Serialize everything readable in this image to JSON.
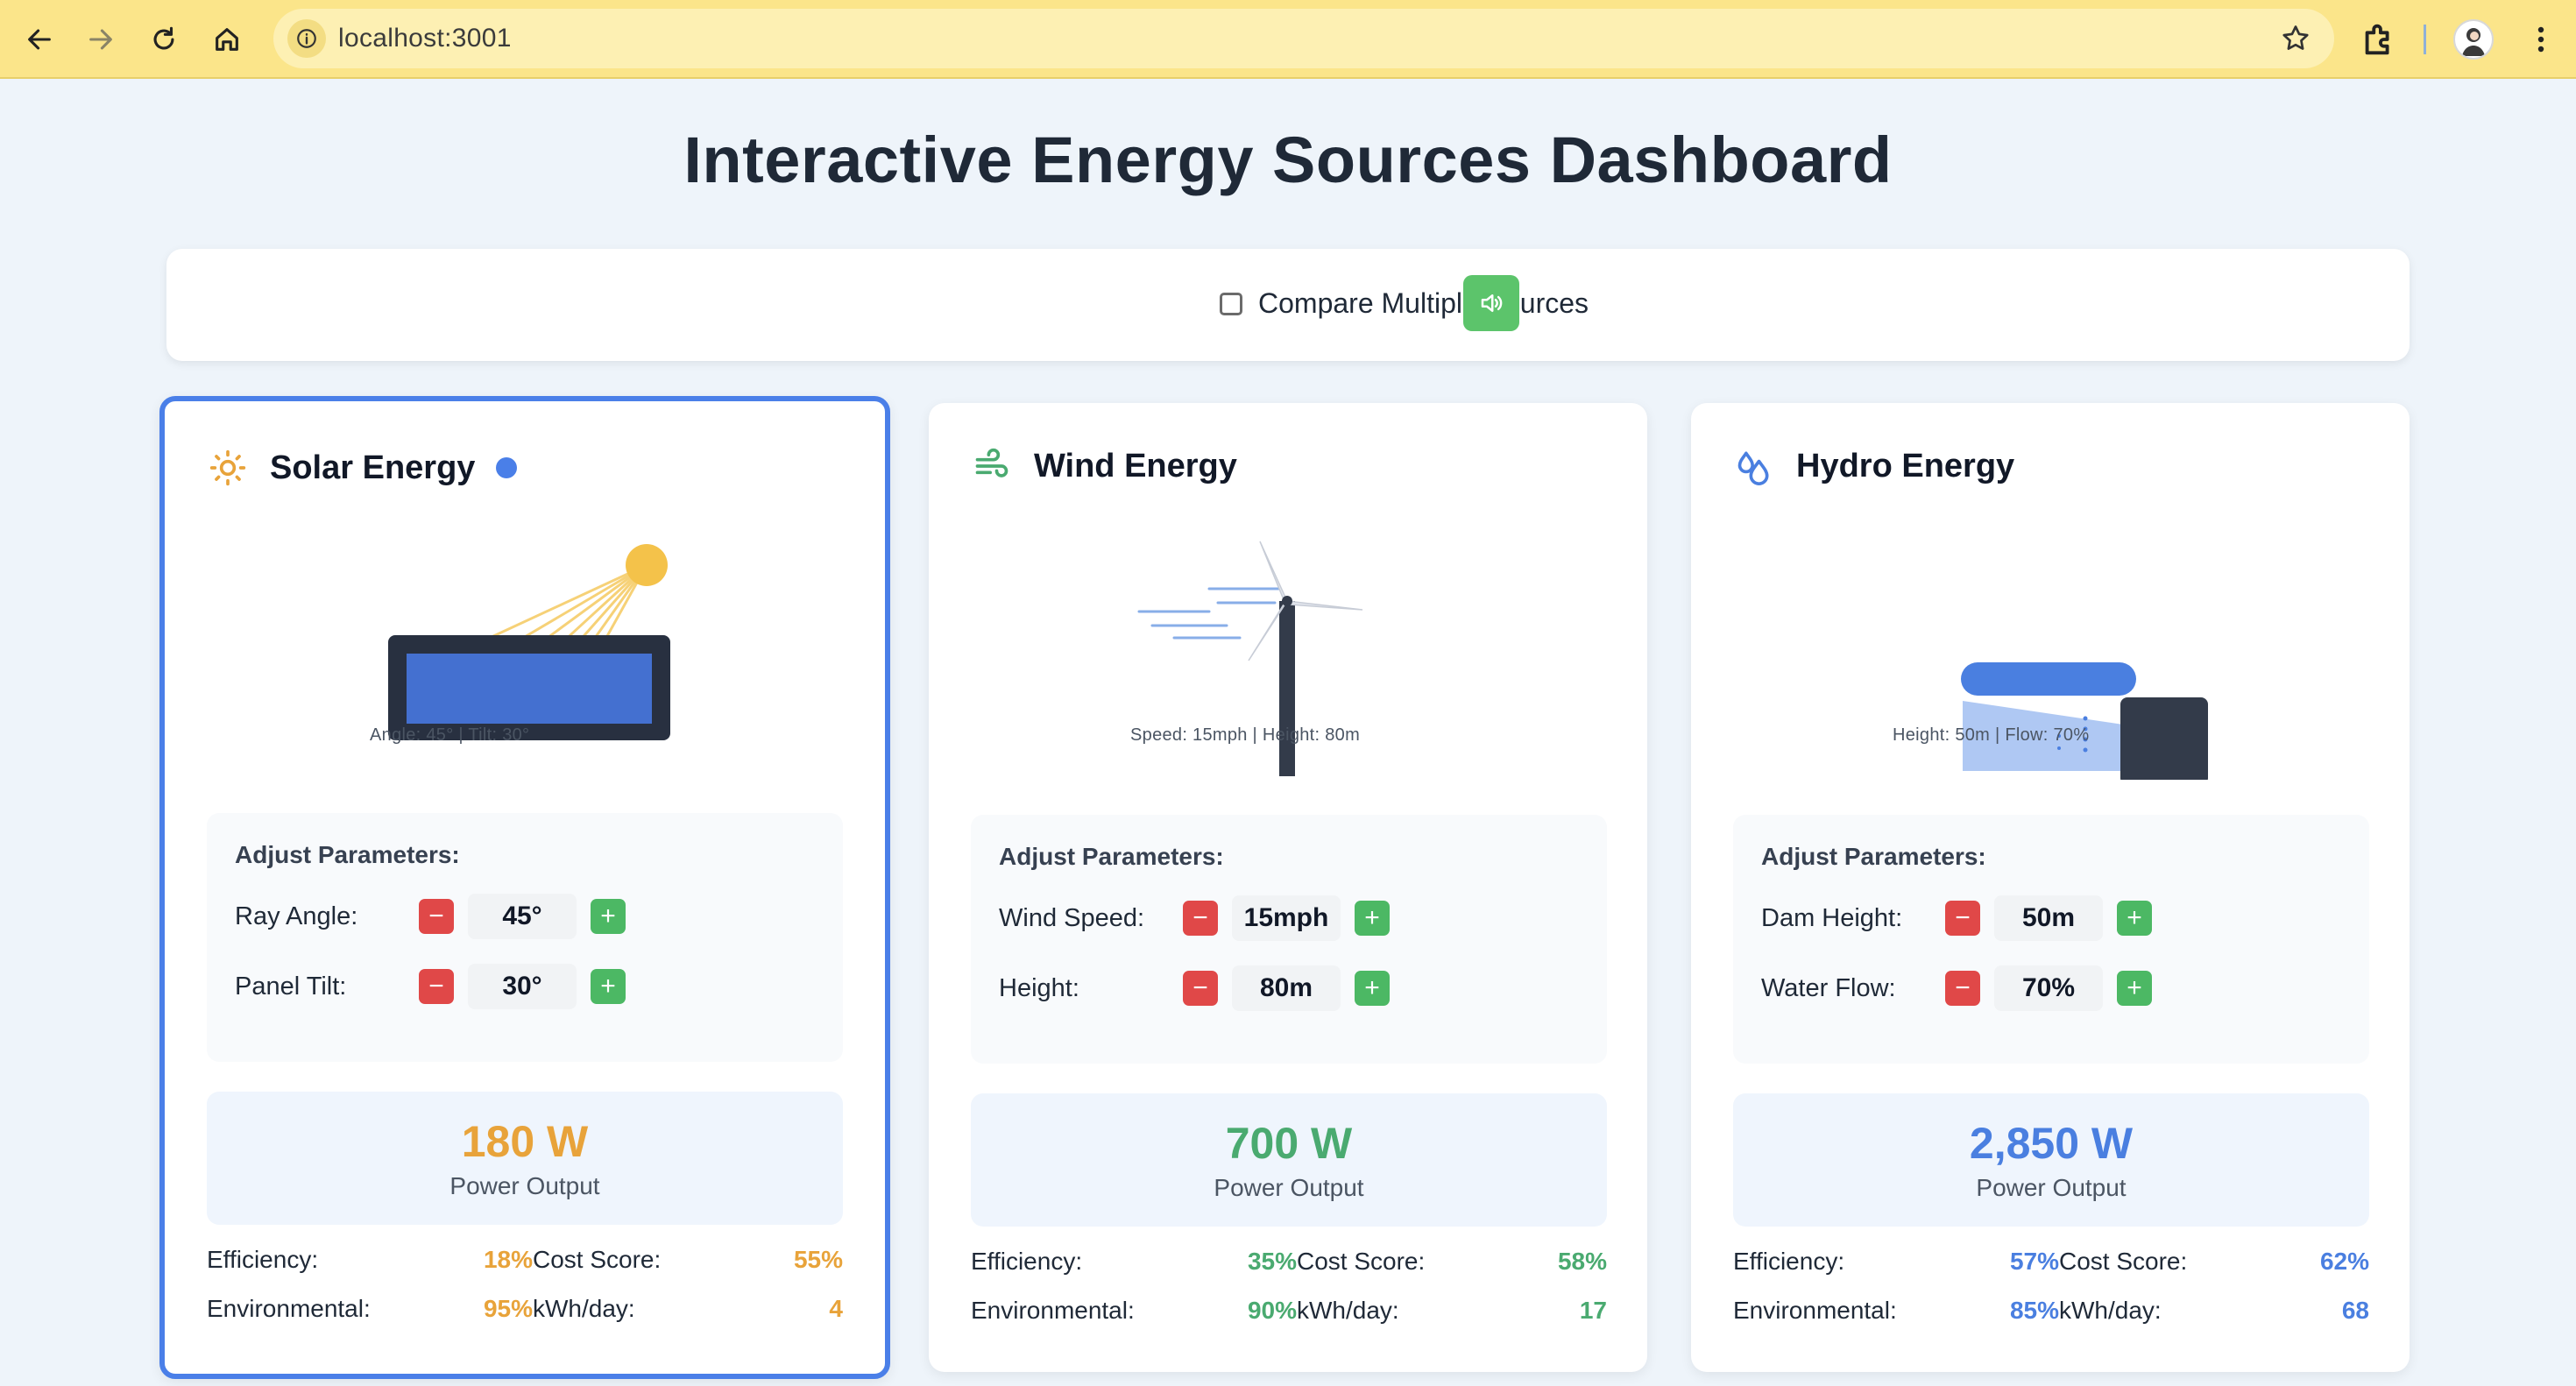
{
  "browser": {
    "url": "localhost:3001"
  },
  "page": {
    "title": "Interactive Energy Sources Dashboard"
  },
  "controls": {
    "compare_label": "Compare Multiple Sources",
    "compare_checked": false
  },
  "colors": {
    "solar": "#e8a33a",
    "wind": "#4aaa70",
    "hydro": "#4a7fe0",
    "selected_border": "#4a7fe8"
  },
  "cards": [
    {
      "title": "Solar Energy",
      "icon": "sun-icon",
      "selected": true,
      "caption": "Angle: 45° | Tilt: 30°",
      "params_title": "Adjust Parameters:",
      "params": [
        {
          "label": "Ray Angle:",
          "value": "45°"
        },
        {
          "label": "Panel Tilt:",
          "value": "30°"
        }
      ],
      "output_value": "180 W",
      "output_label": "Power Output",
      "stats": {
        "efficiency_label": "Efficiency:",
        "efficiency": "18%",
        "cost_label": "Cost Score:",
        "cost": "55%",
        "environmental_label": "Environmental:",
        "environmental": "95%",
        "kwh_label": "kWh/day:",
        "kwh": "4"
      }
    },
    {
      "title": "Wind Energy",
      "icon": "wind-icon",
      "selected": false,
      "caption": "Speed: 15mph | Height: 80m",
      "params_title": "Adjust Parameters:",
      "params": [
        {
          "label": "Wind Speed:",
          "value": "15mph"
        },
        {
          "label": "Height:",
          "value": "80m"
        }
      ],
      "output_value": "700 W",
      "output_label": "Power Output",
      "stats": {
        "efficiency_label": "Efficiency:",
        "efficiency": "35%",
        "cost_label": "Cost Score:",
        "cost": "58%",
        "environmental_label": "Environmental:",
        "environmental": "90%",
        "kwh_label": "kWh/day:",
        "kwh": "17"
      }
    },
    {
      "title": "Hydro Energy",
      "icon": "droplets-icon",
      "selected": false,
      "caption": "Height: 50m | Flow: 70%",
      "params_title": "Adjust Parameters:",
      "params": [
        {
          "label": "Dam Height:",
          "value": "50m"
        },
        {
          "label": "Water Flow:",
          "value": "70%"
        }
      ],
      "output_value": "2,850 W",
      "output_label": "Power Output",
      "stats": {
        "efficiency_label": "Efficiency:",
        "efficiency": "57%",
        "cost_label": "Cost Score:",
        "cost": "62%",
        "environmental_label": "Environmental:",
        "environmental": "85%",
        "kwh_label": "kWh/day:",
        "kwh": "68"
      }
    }
  ]
}
